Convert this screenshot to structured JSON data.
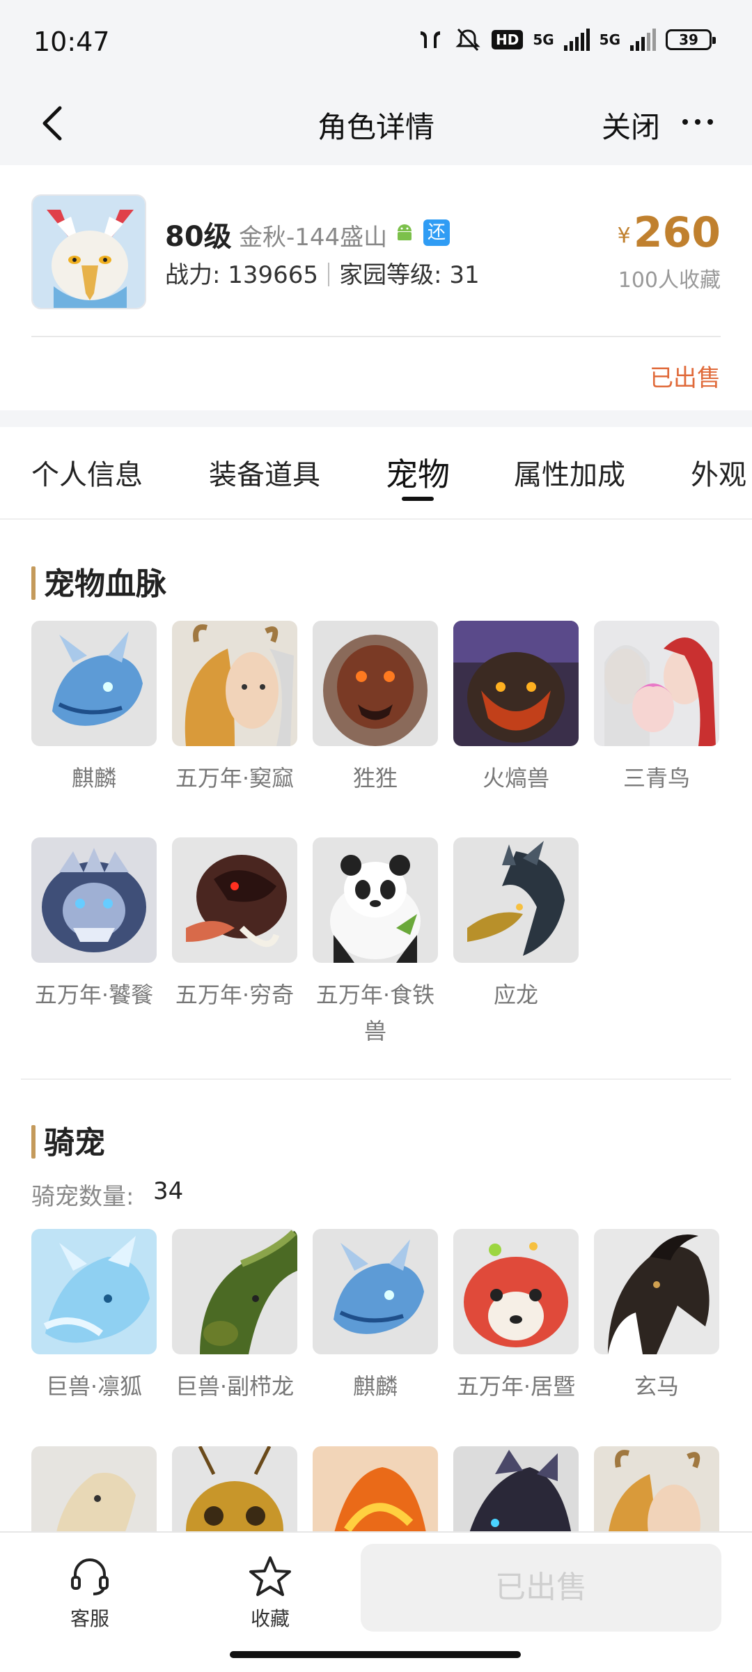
{
  "status": {
    "time": "10:47",
    "net1": "5G",
    "net2": "5G",
    "hd": "HD",
    "battery": "39"
  },
  "nav": {
    "title": "角色详情",
    "close": "关闭"
  },
  "role": {
    "level": "80级",
    "server": "金秋-144盛山",
    "platform_tag": "还",
    "power": "战力: 139665",
    "home_level": "家园等级: 31",
    "currency": "¥",
    "price": "260",
    "favorites": "100人收藏",
    "sale_status": "已出售"
  },
  "tabs": [
    "个人信息",
    "装备道具",
    "宠物",
    "属性加成",
    "外观"
  ],
  "active_tab": "宠物",
  "bloodline": {
    "title": "宠物血脉",
    "pets": [
      {
        "name": "麒麟"
      },
      {
        "name": "五万年·窫窳"
      },
      {
        "name": "狌狌"
      },
      {
        "name": "火熇兽"
      },
      {
        "name": "三青鸟"
      },
      {
        "name": "五万年·饕餮"
      },
      {
        "name": "五万年·穷奇"
      },
      {
        "name": "五万年·食铁兽"
      },
      {
        "name": "应龙"
      }
    ]
  },
  "mounts": {
    "title": "骑宠",
    "count_label": "骑宠数量:",
    "count": "34",
    "pets": [
      {
        "name": "巨兽·凛狐"
      },
      {
        "name": "巨兽·副栉龙"
      },
      {
        "name": "麒麟"
      },
      {
        "name": "五万年·居暨"
      },
      {
        "name": "玄马"
      }
    ]
  },
  "bottom": {
    "service": "客服",
    "favorite": "收藏",
    "sold_button": "已出售"
  },
  "colors": {
    "price": "#c0802e",
    "sold": "#e06a3a",
    "accent_bar": "#c49a5b",
    "tag_blue": "#2f9cf4"
  }
}
